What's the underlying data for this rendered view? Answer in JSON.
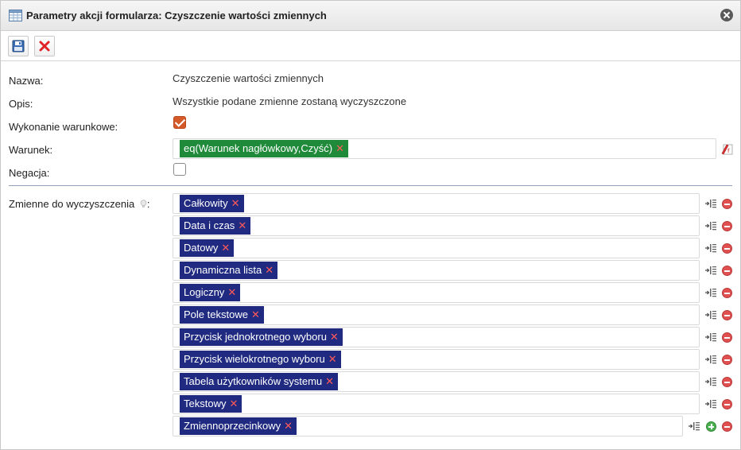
{
  "window": {
    "title": "Parametry akcji formularza: Czyszczenie wartości zmiennych"
  },
  "toolbar": {
    "save_icon": "floppy-disk-icon",
    "cancel_icon": "red-x-icon"
  },
  "form": {
    "name_label": "Nazwa:",
    "name_value": "Czyszczenie wartości zmiennych",
    "desc_label": "Opis:",
    "desc_value": "Wszystkie podane zmienne zostaną wyczyszczone",
    "conditional_label": "Wykonanie warunkowe:",
    "conditional_checked": true,
    "condition_label": "Warunek:",
    "condition_value": "eq(Warunek nagłówkowy,Czyść)",
    "negation_label": "Negacja:",
    "negation_checked": false,
    "variables_label": "Zmienne do wyczyszczenia",
    "variables_label_suffix": ":",
    "variables": [
      "Całkowity",
      "Data i czas",
      "Datowy",
      "Dynamiczna lista",
      "Logiczny",
      "Pole tekstowe",
      "Przycisk jednokrotnego wyboru",
      "Przycisk wielokrotnego wyboru",
      "Tabela użytkowników systemu",
      "Tekstowy",
      "Zmiennoprzecinkowy"
    ]
  },
  "colors": {
    "tag_blue": "#1f2a80",
    "tag_green": "#1f8a3a",
    "checkbox_on": "#d45a2a",
    "remove_red": "#e05050",
    "add_green": "#4caf50"
  }
}
